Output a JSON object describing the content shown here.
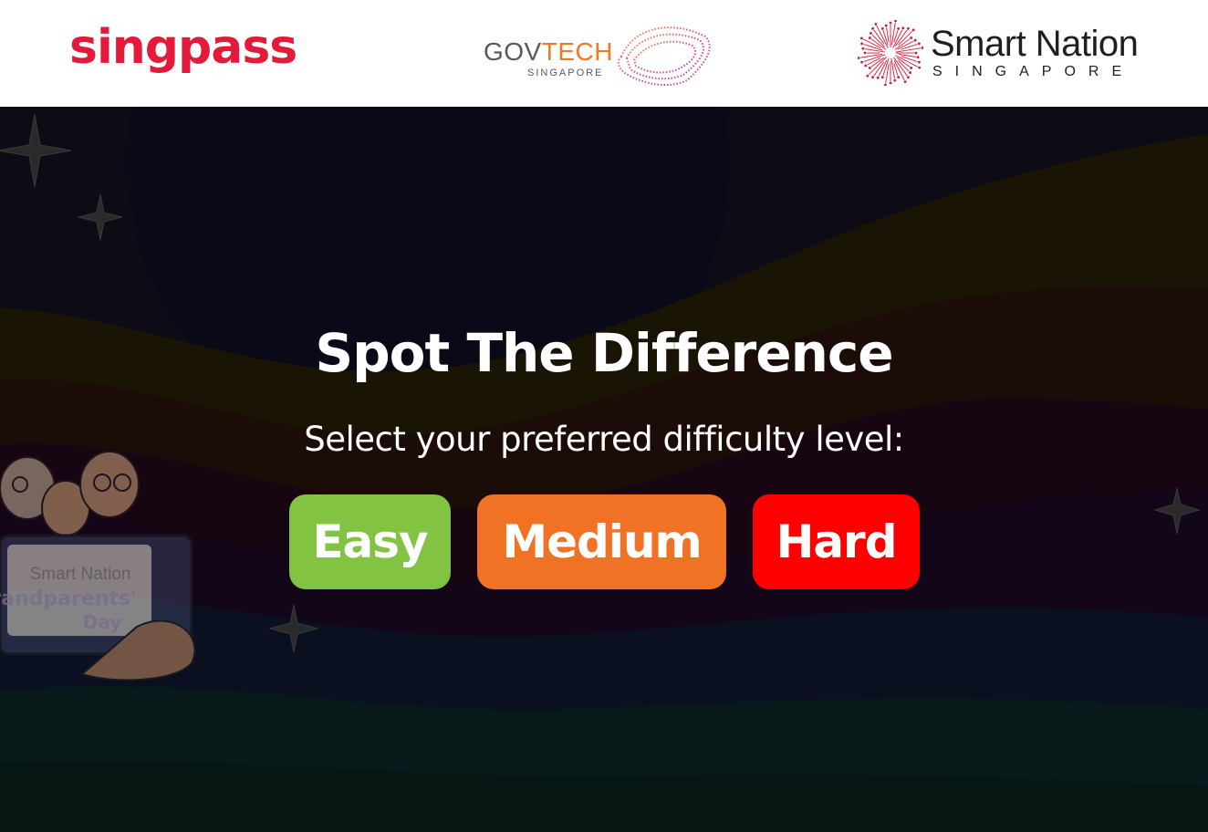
{
  "header": {
    "singpass_logo": "singpass",
    "govtech_logo": {
      "word_gov": "GOV",
      "word_tech": "TECH",
      "sub": "SINGAPORE"
    },
    "smartnation_logo": {
      "title": "Smart Nation",
      "sub": "SINGAPORE"
    }
  },
  "main": {
    "title": "Spot The Difference",
    "subtitle": "Select your preferred difficulty level:",
    "buttons": {
      "easy": "Easy",
      "medium": "Medium",
      "hard": "Hard"
    },
    "mascot_sign": "Smart Nation Grandparents' Day"
  },
  "colors": {
    "singpass_red": "#e31b3b",
    "govtech_orange": "#ef7a22",
    "easy": "#82c341",
    "medium": "#f07224",
    "hard": "#fe0000"
  }
}
